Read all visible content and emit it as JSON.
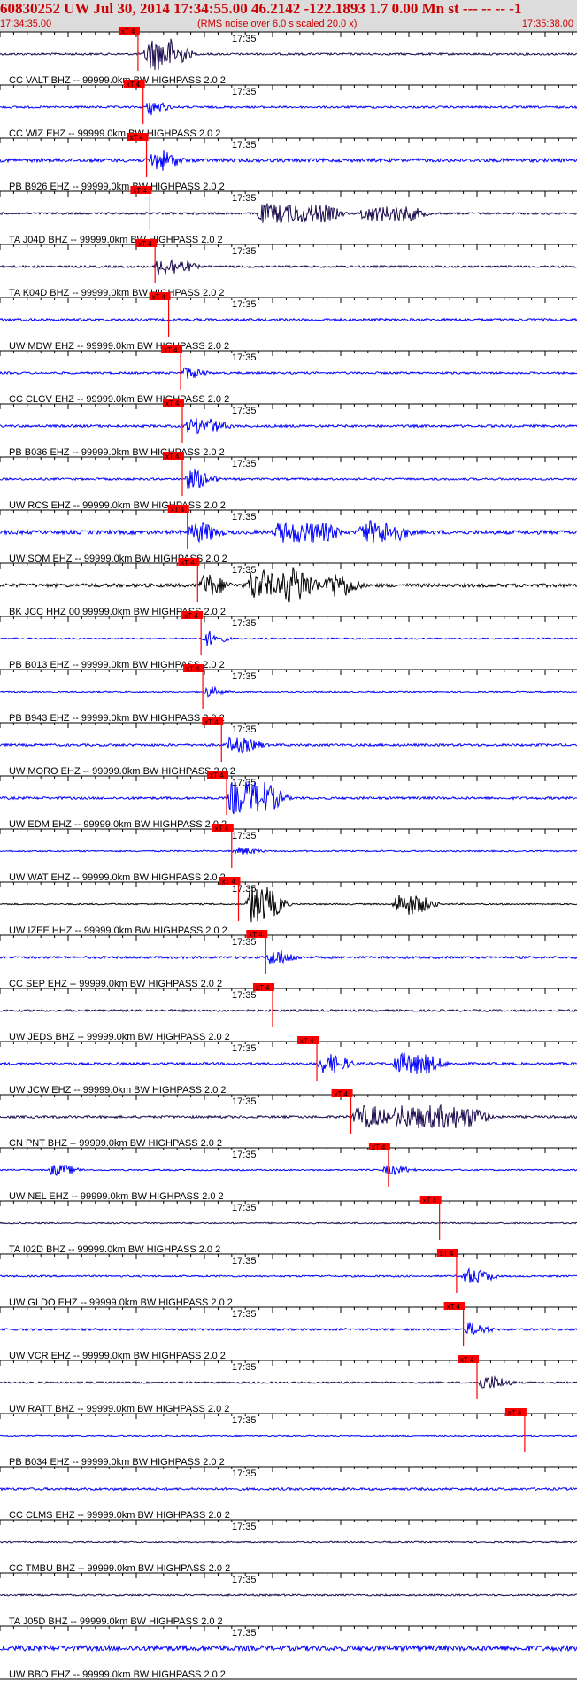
{
  "header": {
    "title": "60830252 UW Jul 30, 2014 17:34:55.00   46.2142 -122.1893  1.7 0.00 Mn st --- -- --  -1",
    "start_time": "17:34:35.00",
    "end_time": "17:35:38.00",
    "noise_note": "(RMS noise over 6.0 s scaled 20.0 x)"
  },
  "tick_label": "17:35",
  "pick_label": "xT 4",
  "colors": {
    "blue": "#0000ff",
    "black": "#000000",
    "navy": "#1a0a4d",
    "pick": "#ff0000",
    "header_bg": "#dcdcdc",
    "header_text": "#cc0000"
  },
  "chart_data": {
    "type": "seismogram",
    "time_range": [
      "17:34:35.00",
      "17:35:38.00"
    ],
    "traces": [
      {
        "label": "CC VALT BHZ -- 99999.0km BW  HIGHPASS  2.0  2",
        "color": "navy",
        "pick_s": 40.5,
        "amp": 0.12,
        "bursts": [
          [
            42,
            50,
            0.85
          ]
        ]
      },
      {
        "label": "CC WIZ EHZ -- 99999.0km BW  HIGHPASS  2.0  2",
        "color": "blue",
        "pick_s": 42.0,
        "amp": 0.12,
        "bursts": [
          [
            42.5,
            44,
            0.45
          ]
        ]
      },
      {
        "label": "PB B926 EHZ -- 99999.0km BW  HIGHPASS  2.0  2",
        "color": "blue",
        "pick_s": 43.0,
        "amp": 0.2,
        "bursts": [
          [
            43.5,
            48,
            0.55
          ]
        ]
      },
      {
        "label": "TA J04D BHZ -- 99999.0km BW  HIGHPASS  2.0  2",
        "color": "navy",
        "pick_s": 44.0,
        "amp": 0.12,
        "bursts": [
          [
            75,
            95,
            0.5
          ],
          [
            105,
            120,
            0.4
          ]
        ]
      },
      {
        "label": "TA K04D BHZ -- 99999.0km BW  HIGHPASS  2.0  2",
        "color": "navy",
        "pick_s": 45.5,
        "amp": 0.12,
        "bursts": [
          [
            45,
            52,
            0.45
          ]
        ]
      },
      {
        "label": "UW MDW EHZ -- 99999.0km BW  HIGHPASS  2.0  2",
        "color": "blue",
        "pick_s": 49.5,
        "amp": 0.14,
        "bursts": []
      },
      {
        "label": "CC CLGV EHZ -- 99999.0km BW  HIGHPASS  2.0  2",
        "color": "blue",
        "pick_s": 53.0,
        "amp": 0.12,
        "bursts": [
          [
            53,
            55,
            0.35
          ]
        ]
      },
      {
        "label": "PB B036 EHZ -- 99999.0km BW  HIGHPASS  2.0  2",
        "color": "blue",
        "pick_s": 53.5,
        "amp": 0.14,
        "bursts": [
          [
            54,
            62,
            0.4
          ]
        ]
      },
      {
        "label": "UW RCS EHZ -- 99999.0km BW  HIGHPASS  2.0  2",
        "color": "blue",
        "pick_s": 53.5,
        "amp": 0.12,
        "bursts": [
          [
            53.5,
            58,
            0.5
          ]
        ]
      },
      {
        "label": "UW SOM EHZ -- 99999.0km BW  HIGHPASS  2.0  2",
        "color": "blue",
        "pick_s": 55.0,
        "amp": 0.22,
        "bursts": [
          [
            55,
            60,
            0.55
          ],
          [
            80,
            95,
            0.55
          ],
          [
            105,
            115,
            0.6
          ]
        ]
      },
      {
        "label": "BK JCC HHZ 00 99999.0km BW  HIGHPASS  2.0  2",
        "color": "black",
        "pick_s": 58.0,
        "amp": 0.2,
        "bursts": [
          [
            58,
            62,
            0.6
          ],
          [
            72,
            78,
            0.8
          ],
          [
            82,
            88,
            0.95
          ],
          [
            95,
            100,
            0.7
          ]
        ]
      },
      {
        "label": "PB B013 EHZ -- 99999.0km BW  HIGHPASS  2.0  2",
        "color": "blue",
        "pick_s": 59.0,
        "amp": 0.08,
        "bursts": [
          [
            59,
            61,
            0.4
          ]
        ]
      },
      {
        "label": "PB B943 EHZ -- 99999.0km BW  HIGHPASS  2.0  2",
        "color": "blue",
        "pick_s": 59.5,
        "amp": 0.08,
        "bursts": [
          [
            59.5,
            61,
            0.3
          ]
        ]
      },
      {
        "label": "UW MORO EHZ -- 99999.0km BW  HIGHPASS  2.0  2",
        "color": "blue",
        "pick_s": 65.0,
        "amp": 0.14,
        "bursts": [
          [
            66,
            72,
            0.4
          ]
        ]
      },
      {
        "label": "UW EDM EHZ -- 99999.0km BW  HIGHPASS  2.0  2",
        "color": "blue",
        "pick_s": 66.5,
        "amp": 0.14,
        "bursts": [
          [
            66.5,
            78,
            0.85
          ]
        ]
      },
      {
        "label": "UW WAT EHZ -- 99999.0km BW  HIGHPASS  2.0  2",
        "color": "blue",
        "pick_s": 68.0,
        "amp": 0.08,
        "bursts": [
          [
            68,
            72,
            0.2
          ]
        ]
      },
      {
        "label": "UW IZEE HHZ -- 99999.0km BW  HIGHPASS  2.0  2",
        "color": "black",
        "pick_s": 70.0,
        "amp": 0.08,
        "bursts": [
          [
            72,
            78,
            0.95
          ],
          [
            115,
            122,
            0.55
          ]
        ]
      },
      {
        "label": "CC SEP EHZ -- 99999.0km BW  HIGHPASS  2.0  2",
        "color": "blue",
        "pick_s": 78.0,
        "amp": 0.14,
        "bursts": [
          [
            78,
            82,
            0.4
          ]
        ]
      },
      {
        "label": "UW JEDS BHZ -- 99999.0km BW  HIGHPASS  2.0  2",
        "color": "navy",
        "pick_s": 80.0,
        "amp": 0.12,
        "bursts": []
      },
      {
        "label": "UW JCW EHZ -- 99999.0km BW  HIGHPASS  2.0  2",
        "color": "blue",
        "pick_s": 93.0,
        "amp": 0.14,
        "bursts": [
          [
            93,
            98,
            0.5
          ],
          [
            115,
            125,
            0.55
          ]
        ]
      },
      {
        "label": "CN PNT BHZ -- 99999.0km BW  HIGHPASS  2.0  2",
        "color": "navy",
        "pick_s": 103.0,
        "amp": 0.14,
        "bursts": [
          [
            103,
            110,
            0.6
          ],
          [
            115,
            138,
            0.6
          ]
        ]
      },
      {
        "label": "UW NEL EHZ -- 99999.0km BW  HIGHPASS  2.0  2",
        "color": "blue",
        "pick_s": 114.0,
        "amp": 0.08,
        "bursts": [
          [
            14,
            18,
            0.3
          ],
          [
            112,
            116,
            0.25
          ]
        ]
      },
      {
        "label": "TA I02D BHZ -- 99999.0km BW  HIGHPASS  2.0  2",
        "color": "navy",
        "pick_s": 129.0,
        "amp": 0.08,
        "bursts": []
      },
      {
        "label": "UW GLDO EHZ -- 99999.0km BW  HIGHPASS  2.0  2",
        "color": "blue",
        "pick_s": 134.0,
        "amp": 0.1,
        "bursts": [
          [
            135,
            140,
            0.4
          ]
        ]
      },
      {
        "label": "UW VCR EHZ -- 99999.0km BW  HIGHPASS  2.0  2",
        "color": "blue",
        "pick_s": 136.0,
        "amp": 0.12,
        "bursts": [
          [
            136,
            139,
            0.35
          ]
        ]
      },
      {
        "label": "UW RATT BHZ -- 99999.0km BW  HIGHPASS  2.0  2",
        "color": "navy",
        "pick_s": 140.0,
        "amp": 0.1,
        "bursts": [
          [
            140,
            145,
            0.35
          ]
        ]
      },
      {
        "label": "PB B034 EHZ -- 99999.0km BW  HIGHPASS  2.0  2",
        "color": "blue",
        "pick_s": 154.0,
        "amp": 0.08,
        "bursts": []
      },
      {
        "label": "CC CLMS EHZ -- 99999.0km BW  HIGHPASS  2.0  2",
        "color": "blue",
        "pick_s": null,
        "amp": 0.14,
        "bursts": []
      },
      {
        "label": "CC TMBU BHZ -- 99999.0km BW  HIGHPASS  2.0  2",
        "color": "navy",
        "pick_s": null,
        "amp": 0.08,
        "bursts": []
      },
      {
        "label": "TA J05D BHZ -- 99999.0km BW  HIGHPASS  2.0  2",
        "color": "navy",
        "pick_s": null,
        "amp": 0.1,
        "bursts": []
      },
      {
        "label": "UW BBO EHZ -- 99999.0km BW  HIGHPASS  2.0  2",
        "color": "blue",
        "pick_s": null,
        "amp": 0.3,
        "bursts": []
      }
    ]
  }
}
